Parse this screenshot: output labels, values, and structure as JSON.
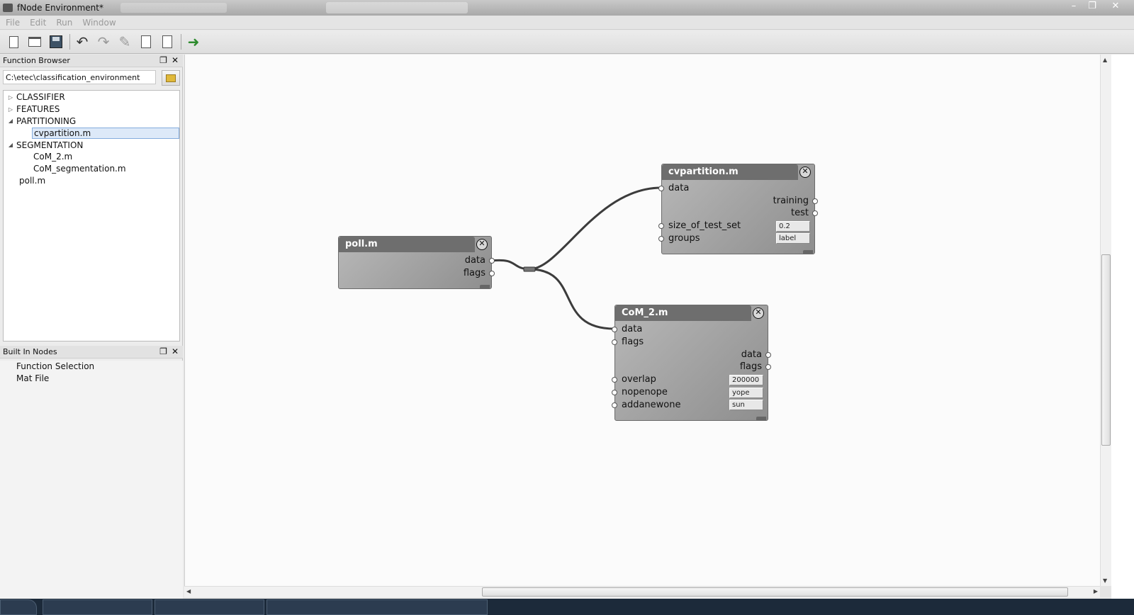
{
  "window": {
    "title": "fNode Environment*"
  },
  "menu": [
    "File",
    "Edit",
    "Run",
    "Window"
  ],
  "toolbar": {
    "buttons": [
      "new-file-icon",
      "open-file-icon",
      "save-icon",
      "undo-icon",
      "redo-icon",
      "clear-icon",
      "copy-icon",
      "paste-icon",
      "run-icon"
    ]
  },
  "function_browser": {
    "title": "Function Browser",
    "path": "C:\\etec\\classification_environment",
    "tree": [
      {
        "label": "CLASSIFIER",
        "state": "collapsed"
      },
      {
        "label": "FEATURES",
        "state": "collapsed"
      },
      {
        "label": "PARTITIONING",
        "state": "expanded"
      },
      {
        "label": "cvpartition.m",
        "state": "child-selected"
      },
      {
        "label": "SEGMENTATION",
        "state": "expanded"
      },
      {
        "label": "CoM_2.m",
        "state": "child"
      },
      {
        "label": "CoM_segmentation.m",
        "state": "child"
      },
      {
        "label": "poll.m",
        "state": "leaf"
      }
    ]
  },
  "built_in_nodes": {
    "title": "Built In Nodes",
    "items": [
      "Function Selection",
      "Mat File"
    ]
  },
  "nodes": {
    "poll": {
      "title": "poll.m",
      "outputs": [
        "data",
        "flags"
      ]
    },
    "cvpartition": {
      "title": "cvpartition.m",
      "inputs": [
        "data"
      ],
      "outputs": [
        "training",
        "test"
      ],
      "params": [
        {
          "name": "size_of_test_set",
          "value": "0.2"
        },
        {
          "name": "groups",
          "value": "label"
        }
      ]
    },
    "com2": {
      "title": "CoM_2.m",
      "inputs": [
        "data",
        "flags"
      ],
      "outputs": [
        "data",
        "flags"
      ],
      "params": [
        {
          "name": "overlap",
          "value": "200000"
        },
        {
          "name": "nopenope",
          "value": "yope"
        },
        {
          "name": "addanewone",
          "value": "sun"
        }
      ]
    }
  },
  "colors": {
    "node_title_bg": "#6e6e6e",
    "selection": "#dde9f8",
    "run_arrow": "#2e8b2e"
  }
}
